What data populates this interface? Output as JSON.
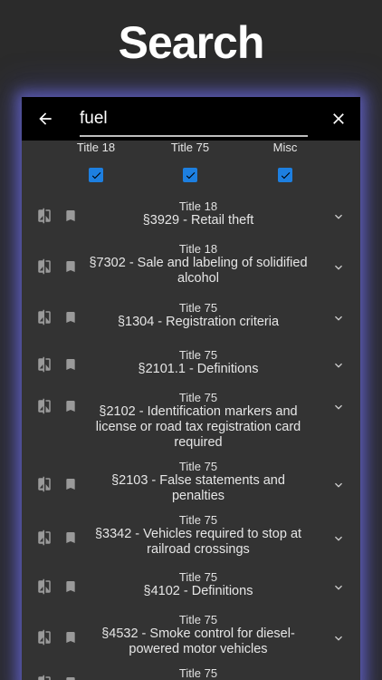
{
  "header": {
    "title": "Search"
  },
  "search": {
    "value": "fuel",
    "placeholder": ""
  },
  "filters": [
    {
      "label": "Title 18",
      "checked": true
    },
    {
      "label": "Title 75",
      "checked": true
    },
    {
      "label": "Misc",
      "checked": true
    }
  ],
  "results": [
    {
      "title": "Title 18",
      "section": "§3929 - Retail theft"
    },
    {
      "title": "Title 18",
      "section": "§7302 - Sale and labeling of solidified alcohol"
    },
    {
      "title": "Title 75",
      "section": "§1304 - Registration criteria"
    },
    {
      "title": "Title 75",
      "section": "§2101.1 - Definitions"
    },
    {
      "title": "Title 75",
      "section": "§2102 - Identification markers and license or road tax registration card required"
    },
    {
      "title": "Title 75",
      "section": "§2103 - False statements and penalties"
    },
    {
      "title": "Title 75",
      "section": "§3342 - Vehicles required to stop at railroad crossings"
    },
    {
      "title": "Title 75",
      "section": "§4102 - Definitions"
    },
    {
      "title": "Title 75",
      "section": "§4532 - Smoke control for diesel-powered motor vehicles"
    },
    {
      "title": "Title 75",
      "section": ""
    }
  ],
  "icons": {
    "back": "arrow-left-icon",
    "close": "close-icon",
    "compare": "compare-icon",
    "bookmark": "bookmark-icon",
    "expand": "chevron-down-icon"
  },
  "colors": {
    "accent": "#1d7fe0",
    "glow": "#7878ff",
    "search_bar": "#000000",
    "panel": "#333333"
  }
}
